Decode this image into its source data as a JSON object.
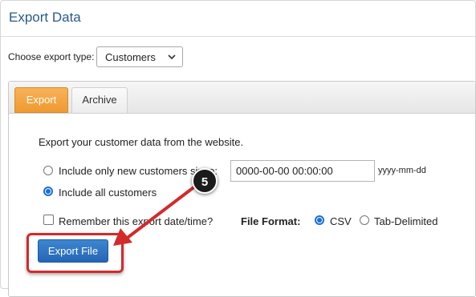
{
  "header": {
    "title": "Export Data"
  },
  "export_type": {
    "label": "Choose export type:",
    "selected": "Customers"
  },
  "tabs": [
    {
      "label": "Export",
      "active": true
    },
    {
      "label": "Archive",
      "active": false
    }
  ],
  "form": {
    "intro": "Export your customer data from the website.",
    "radio_new_label": "Include only new customers since:",
    "radio_all_label": "Include all customers",
    "date_value": "0000-00-00 00:00:00",
    "date_format": "yyyy-mm-dd",
    "remember_label": "Remember this export date/time?",
    "file_format_label": "File Format:",
    "format_csv": "CSV",
    "format_tab": "Tab-Delimited",
    "export_button": "Export File"
  },
  "annotation": {
    "step": "5",
    "color": "#d12b2b"
  },
  "colors": {
    "accent_tab": "#ef9a30",
    "button": "#2566b5",
    "title": "#2a5a8a"
  }
}
